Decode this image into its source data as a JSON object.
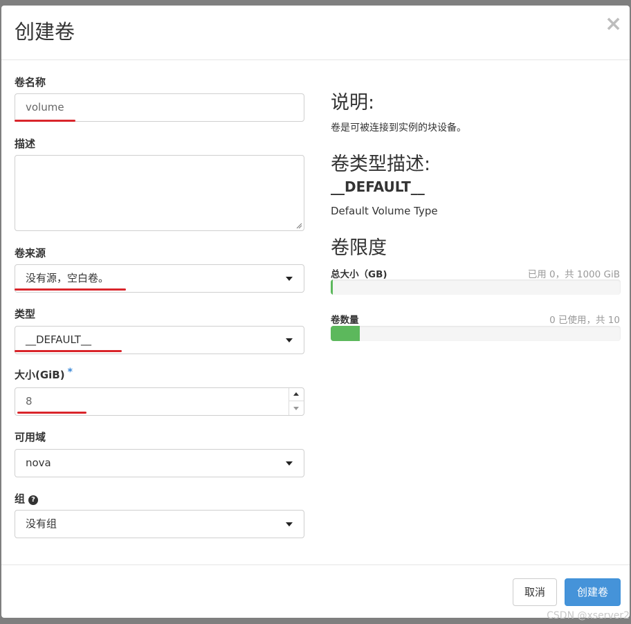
{
  "dialog": {
    "title": "创建卷",
    "close_glyph": "×"
  },
  "form": {
    "name_label": "卷名称",
    "name_value": "volume",
    "description_label": "描述",
    "description_value": "",
    "source_label": "卷来源",
    "source_value": "没有源，空白卷。",
    "type_label": "类型",
    "type_value": "__DEFAULT__",
    "size_label": "大小(GiB)",
    "size_required": "*",
    "size_value": "8",
    "az_label": "可用域",
    "az_value": "nova",
    "group_label": "组",
    "group_help_glyph": "?",
    "group_value": "没有组"
  },
  "info": {
    "description_heading": "说明:",
    "description_text": "卷是可被连接到实例的块设备。",
    "type_heading": "卷类型描述:",
    "type_name": "__DEFAULT__",
    "type_desc": "Default Volume Type",
    "limits_heading": "卷限度",
    "total_size_label": "总大小（GB)",
    "total_size_text": "已用 0，共 1000 GiB",
    "total_size_fraction": 0.004,
    "count_label": "卷数量",
    "count_text": "0 已使用，共 10",
    "count_fraction": 0.1
  },
  "footer": {
    "cancel_label": "取消",
    "submit_label": "创建卷"
  },
  "watermark": "CSDN @xserver2",
  "colors": {
    "primary": "#4593d9",
    "progress": "#5cb85c",
    "annotation": "#d9252b",
    "required": "#3a87d6"
  }
}
